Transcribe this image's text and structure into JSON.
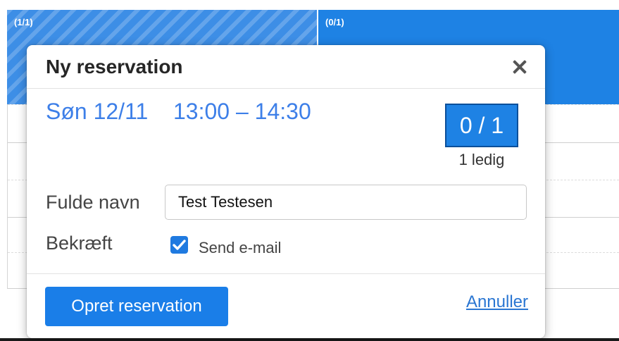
{
  "calendar": {
    "events": [
      {
        "count_label": "(1/1)"
      },
      {
        "count_label": "(0/1)"
      }
    ]
  },
  "modal": {
    "title": "Ny reservation",
    "date": "Søn 12/11",
    "time": "13:00 – 14:30",
    "capacity": {
      "value": "0 / 1",
      "free_label": "1 ledig"
    },
    "form": {
      "name_label": "Fulde navn",
      "name_value": "Test Testesen",
      "confirm_label": "Bekræft",
      "send_email_label": "Send e-mail",
      "send_email_checked": true
    },
    "footer": {
      "submit_label": "Opret reservation",
      "cancel_label": "Annuller"
    }
  },
  "colors": {
    "accent": "#1e82e4",
    "slot_text": "#3d7fe8",
    "link": "#2a76d2"
  },
  "icons": {
    "close": "close-icon",
    "check": "checkmark-icon"
  }
}
